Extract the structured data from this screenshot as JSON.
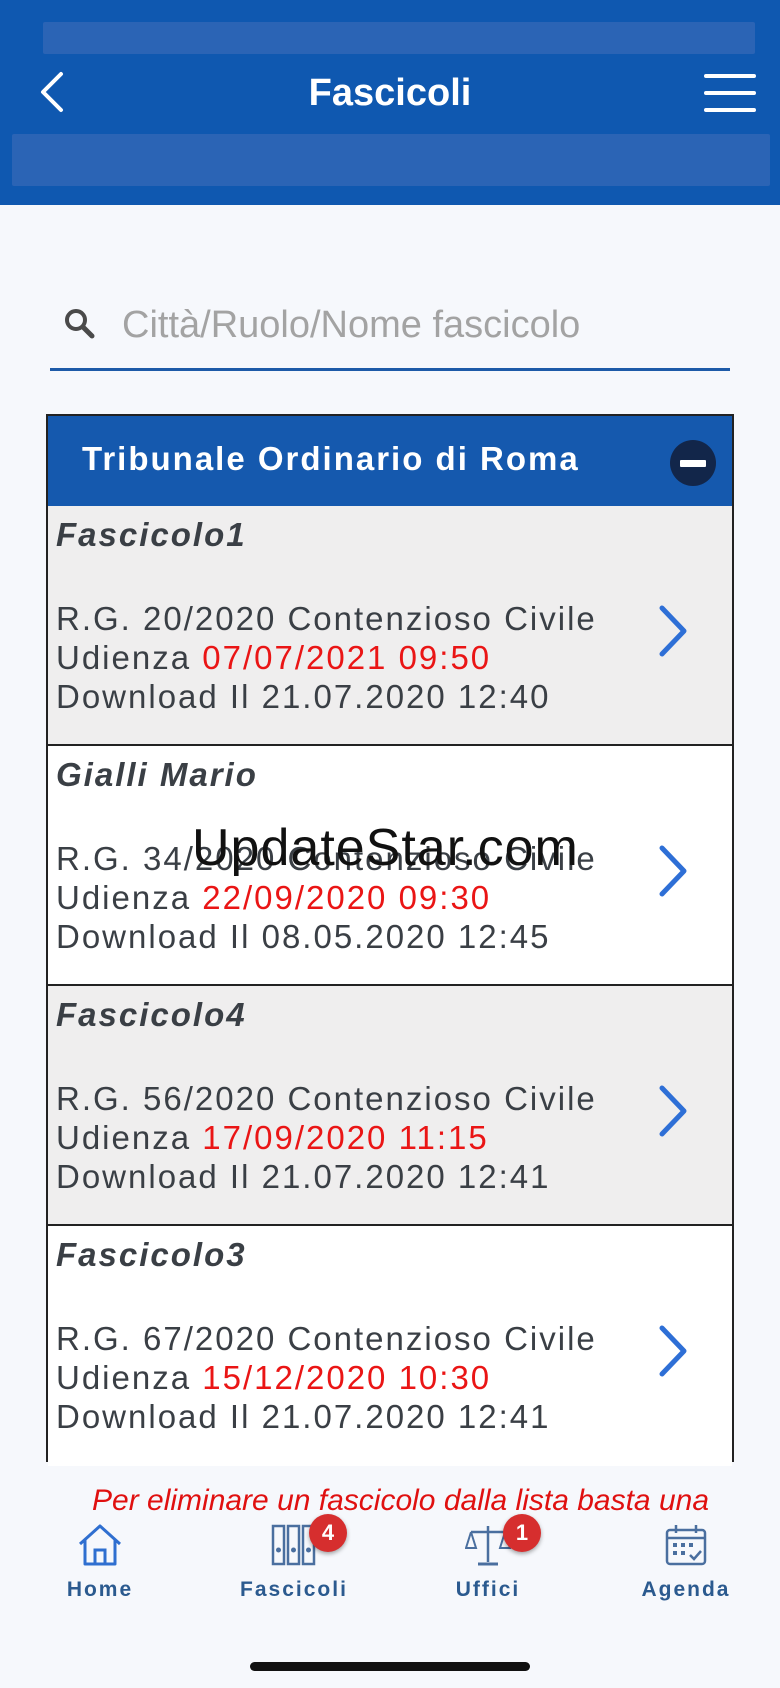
{
  "header": {
    "title": "Fascicoli",
    "back_icon": "chevron-left-icon",
    "menu_icon": "hamburger-menu-icon",
    "color": "#0f58b0"
  },
  "search": {
    "placeholder": "Città/Ruolo/Nome fascicolo",
    "value": ""
  },
  "group": {
    "title": "Tribunale Ordinario di Roma",
    "collapse_icon": "minus-circle-icon",
    "items": [
      {
        "name": "Fascicolo1",
        "rg": "R.G. 20/2020 Contenzioso Civile",
        "hearing_label": "Udienza",
        "hearing_date": "07/07/2021 09:50",
        "download": "Download Il 21.07.2020 12:40"
      },
      {
        "name": "Gialli Mario",
        "rg": "R.G. 34/2020 Contenzioso Civile",
        "hearing_label": "Udienza",
        "hearing_date": "22/09/2020 09:30",
        "download": "Download Il 08.05.2020 12:45"
      },
      {
        "name": "Fascicolo4",
        "rg": "R.G. 56/2020 Contenzioso Civile",
        "hearing_label": "Udienza",
        "hearing_date": "17/09/2020 11:15",
        "download": "Download Il 21.07.2020 12:41"
      },
      {
        "name": "Fascicolo3",
        "rg": "R.G. 67/2020 Contenzioso Civile",
        "hearing_label": "Udienza",
        "hearing_date": "15/12/2020 10:30",
        "download": "Download Il 21.07.2020 12:41"
      }
    ]
  },
  "note": "Per eliminare un fascicolo dalla lista basta una",
  "watermark": "UpdateStar.com",
  "tabbar": {
    "tabs": [
      {
        "label": "Home",
        "icon": "home-icon"
      },
      {
        "label": "Fascicoli",
        "icon": "binders-icon",
        "badge": "4"
      },
      {
        "label": "Uffici",
        "icon": "scales-icon",
        "badge": "1"
      },
      {
        "label": "Agenda",
        "icon": "calendar-icon"
      }
    ]
  },
  "colors": {
    "accent": "#1559ae",
    "hearing_date": "#ea1515",
    "badge": "#d62e2e"
  }
}
